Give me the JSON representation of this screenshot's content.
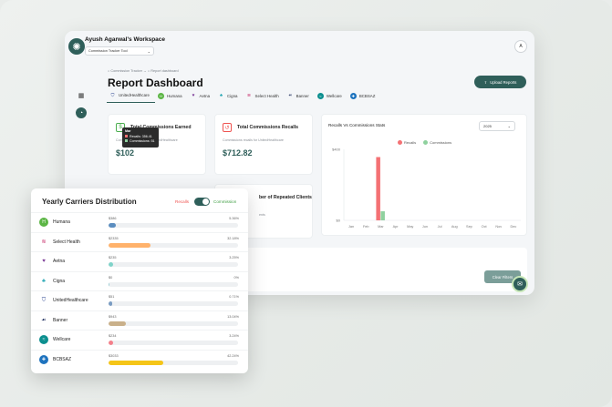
{
  "workspace": {
    "title": "Ayush Agarwal's Workspace",
    "selector_value": "Commission Tracker Tool",
    "avatar_initial": "A"
  },
  "breadcrumb": [
    "Commission Tracker",
    "Report dashboard"
  ],
  "page_title": "Report Dashboard",
  "upload_label": "Upload Reports",
  "tabs": [
    {
      "label": "UnitedHealthcare",
      "icon": "shield-icon",
      "color": "#1e3a8a",
      "active": true
    },
    {
      "label": "Humana",
      "icon": "humana-h-icon",
      "color": "#5bb544"
    },
    {
      "label": "Aetna",
      "icon": "heart-icon",
      "color": "#7d3c98"
    },
    {
      "label": "Cigna",
      "icon": "tree-icon",
      "color": "#2aa8b5"
    },
    {
      "label": "Select Health",
      "icon": "select-health-icon",
      "color": "#c2185b"
    },
    {
      "label": "Banner",
      "icon": "banner-icon",
      "color": "#2b3a67"
    },
    {
      "label": "Wellcare",
      "icon": "wellcare-icon",
      "color": "#0c8f8f"
    },
    {
      "label": "BCBSAZ",
      "icon": "bcbs-icon",
      "color": "#1e73be"
    }
  ],
  "cards": {
    "commissions": {
      "title": "Total Commissions Earned",
      "subtitle": "Commissions earned for UnitedHealthcare",
      "value": "$102"
    },
    "recalls": {
      "title": "Total Commissions Recalls",
      "subtitle": "Commissions recalls for UnitedHealthcare",
      "value": "$712.82"
    },
    "repeated": {
      "title": "ber of Repeated Clients",
      "subtitle": "ents"
    }
  },
  "stats": {
    "title": "Recalls Vs Commissions Stats",
    "year": "2025",
    "legend": [
      {
        "name": "Recalls",
        "color": "#f47174"
      },
      {
        "name": "Commissions",
        "color": "#8fd19e"
      }
    ],
    "tooltip": {
      "title": "Mar",
      "recalls": "Recalls: 356.41",
      "commissions": "Commissions: 51"
    }
  },
  "chart_data": {
    "type": "bar",
    "categories": [
      "Jan",
      "Feb",
      "Mar",
      "Apr",
      "May",
      "Jun",
      "Jul",
      "Aug",
      "Sep",
      "Oct",
      "Nov",
      "Dec"
    ],
    "series": [
      {
        "name": "Recalls",
        "values": [
          0,
          0,
          356.41,
          0,
          0,
          0,
          0,
          0,
          0,
          0,
          0,
          0
        ]
      },
      {
        "name": "Commissions",
        "values": [
          0,
          0,
          51,
          0,
          0,
          0,
          0,
          0,
          0,
          0,
          0,
          0
        ]
      }
    ],
    "y_ticks": [
      "$0",
      "$400"
    ],
    "ylim": [
      0,
      400
    ]
  },
  "clear_filters_label": "Clear Filters",
  "distribution": {
    "title": "Yearly Carriers Distribution",
    "toggle_left": "Recalls",
    "toggle_right": "Commission",
    "rows": [
      {
        "name": "Humana",
        "amount": "$386",
        "percent": "5.36%",
        "fraction": 0.0536,
        "color": "#5b8dbf",
        "icon": "humana-h-icon",
        "icon_color": "#5bb544"
      },
      {
        "name": "Select Health",
        "amount": "$2335",
        "percent": "32.18%",
        "fraction": 0.3218,
        "color": "#ffb26b",
        "icon": "select-health-icon",
        "icon_color": "#c2185b"
      },
      {
        "name": "Aetna",
        "amount": "$235",
        "percent": "3.25%",
        "fraction": 0.0325,
        "color": "#7fd3c9",
        "icon": "heart-icon",
        "icon_color": "#7d3c98"
      },
      {
        "name": "Cigna",
        "amount": "$0",
        "percent": "0%",
        "fraction": 0.0,
        "color": "#9ecfd6",
        "icon": "tree-icon",
        "icon_color": "#2aa8b5"
      },
      {
        "name": "UnitedHealthcare",
        "amount": "$51",
        "percent": "0.71%",
        "fraction": 0.0071,
        "color": "#7a9cc2",
        "icon": "shield-icon",
        "icon_color": "#1e3a8a"
      },
      {
        "name": "Banner",
        "amount": "$943",
        "percent": "13.04%",
        "fraction": 0.1304,
        "color": "#c9b08a",
        "icon": "banner-icon",
        "icon_color": "#2b3a67"
      },
      {
        "name": "Wellcare",
        "amount": "$234",
        "percent": "3.24%",
        "fraction": 0.0324,
        "color": "#f47f8a",
        "icon": "wellcare-icon",
        "icon_color": "#0c8f8f"
      },
      {
        "name": "BCBSAZ",
        "amount": "$3033",
        "percent": "42.24%",
        "fraction": 0.4224,
        "color": "#f5c518",
        "icon": "bcbs-icon",
        "icon_color": "#1e73be"
      }
    ]
  }
}
